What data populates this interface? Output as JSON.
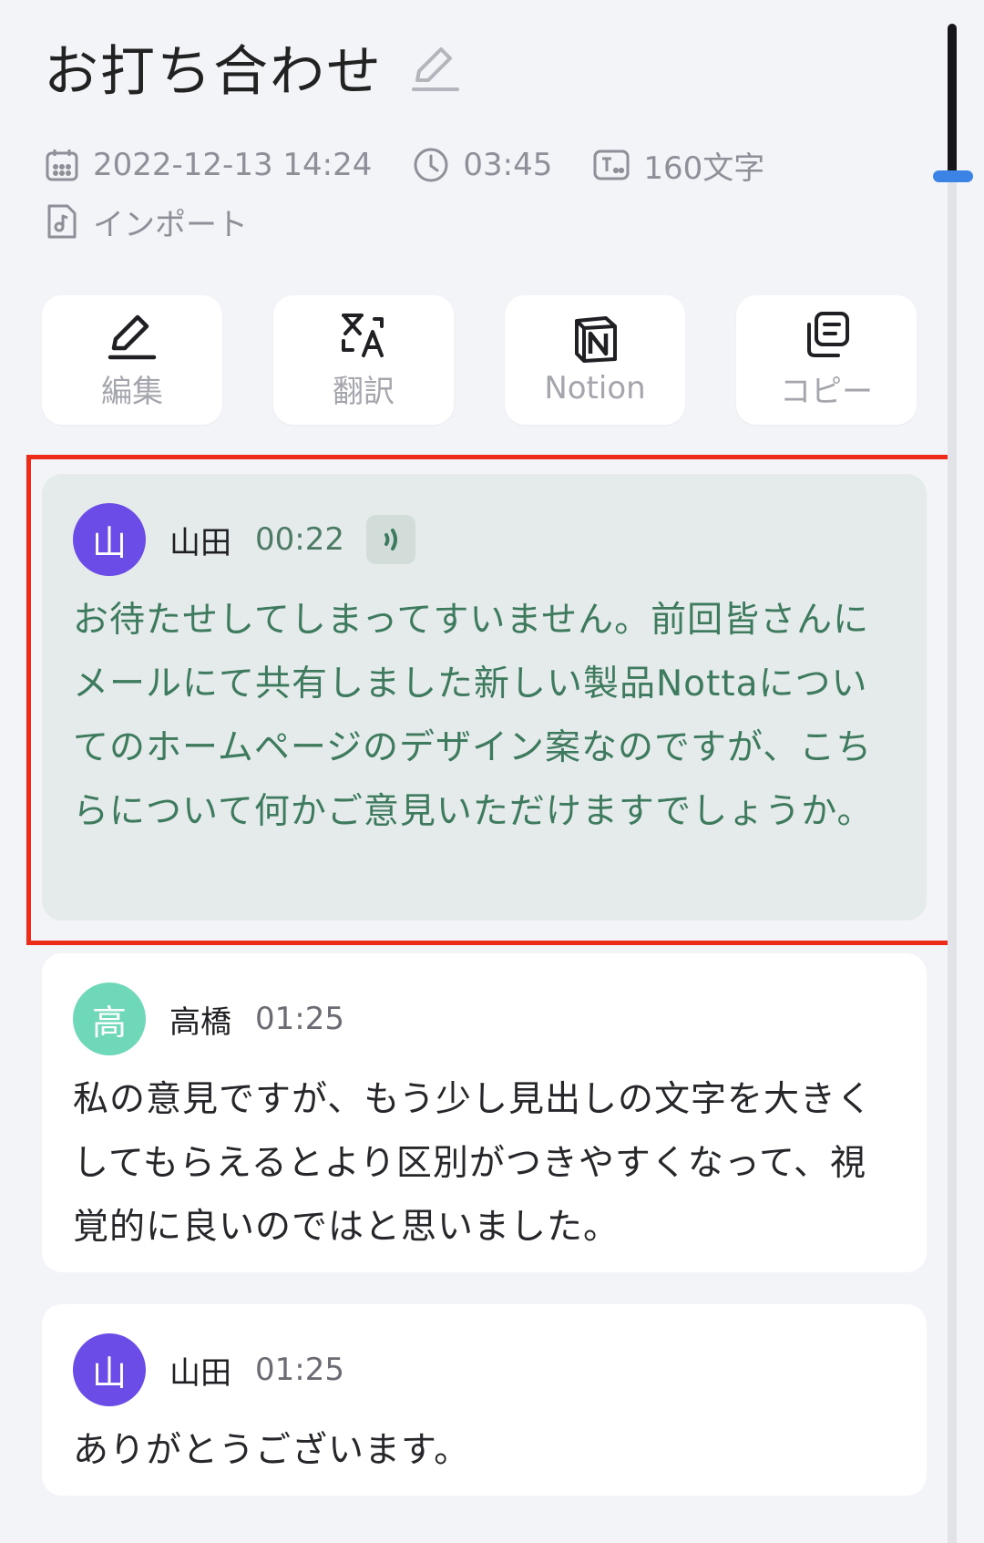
{
  "header": {
    "title": "お打ち合わせ",
    "datetime": "2022-12-13 14:24",
    "duration": "03:45",
    "char_count": "160文字",
    "source": "インポート"
  },
  "actions": {
    "edit": "編集",
    "translate": "翻訳",
    "notion": "Notion",
    "copy": "コピー"
  },
  "transcript": [
    {
      "avatar": "山",
      "avatar_color": "#6b4ce6",
      "speaker": "山田",
      "time": "00:22",
      "text": "お待たせしてしまってすいません。前回皆さんにメールにて共有しました新しい製品Nottaについてのホームページのデザイン案なのですが、こちらについて何かご意見いただけますでしょうか。"
    },
    {
      "avatar": "高",
      "avatar_color": "#6fd8b8",
      "speaker": "高橋",
      "time": "01:25",
      "text": "私の意見ですが、もう少し見出しの文字を大きくしてもらえるとより区別がつきやすくなって、視覚的に良いのではと思いました。"
    },
    {
      "avatar": "山",
      "avatar_color": "#6b4ce6",
      "speaker": "山田",
      "time": "01:25",
      "text": "ありがとうございます。"
    }
  ],
  "colors": {
    "accent_scroll": "#3b84e6",
    "highlight_border": "#ee2a18",
    "active_text": "#3e7a5e"
  }
}
